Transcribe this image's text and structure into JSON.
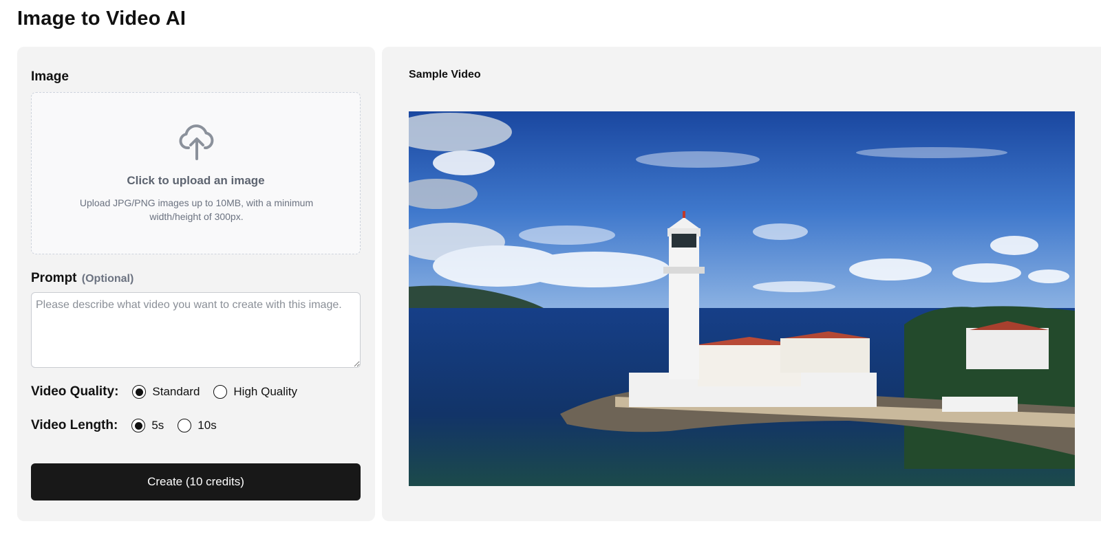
{
  "page": {
    "title": "Image to Video AI"
  },
  "image_section": {
    "label": "Image",
    "upload_title": "Click to upload an image",
    "upload_description": "Upload JPG/PNG images up to 10MB, with a minimum width/height of 300px.",
    "icon": "cloud-upload-icon"
  },
  "prompt": {
    "label": "Prompt",
    "optional_label": "(Optional)",
    "placeholder": "Please describe what video you want to create with this image.",
    "value": ""
  },
  "video_quality": {
    "label": "Video Quality:",
    "options": [
      {
        "label": "Standard",
        "selected": true
      },
      {
        "label": "High Quality",
        "selected": false
      }
    ]
  },
  "video_length": {
    "label": "Video Length:",
    "options": [
      {
        "label": "5s",
        "selected": true
      },
      {
        "label": "10s",
        "selected": false
      }
    ]
  },
  "create_button": {
    "label": "Create (10 credits)"
  },
  "sample": {
    "label": "Sample Video"
  },
  "colors": {
    "panel_bg": "#f3f3f3",
    "button_bg": "#181818",
    "muted_text": "#6b7280"
  }
}
